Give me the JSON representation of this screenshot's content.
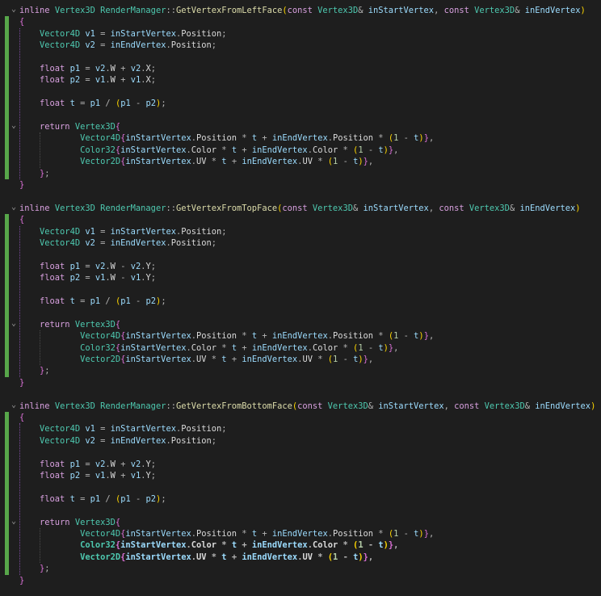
{
  "editor": {
    "functions": [
      {
        "signature": {
          "inline": "inline",
          "ret": "Vertex3D",
          "cls": "RenderManager",
          "sep": "::",
          "name": "GetVertexFromLeftFace",
          "open": "(",
          "c1": "const",
          "t1": "Vertex3D",
          "amp1": "&",
          "p1": "inStartVertex",
          "comma": ",",
          "c2": "const",
          "t2": "Vertex3D",
          "amp2": "&",
          "p2": "inEndVertex",
          "close": ")"
        },
        "body": [
          "{",
          "    Vector4D v1 = inStartVertex.Position;",
          "    Vector4D v2 = inEndVertex.Position;",
          "",
          "    float p1 = v2.W + v2.X;",
          "    float p2 = v1.W + v1.X;",
          "",
          "    float t = p1 / (p1 - p2);",
          "",
          "    return Vertex3D{",
          "            Vector4D{inStartVertex.Position * t + inEndVertex.Position * (1 - t)},",
          "            Color32{inStartVertex.Color * t + inEndVertex.Color * (1 - t)},",
          "            Vector2D{inStartVertex.UV * t + inEndVertex.UV * (1 - t)},",
          "    };",
          "}"
        ]
      },
      {
        "signature": {
          "inline": "inline",
          "ret": "Vertex3D",
          "cls": "RenderManager",
          "sep": "::",
          "name": "GetVertexFromTopFace",
          "open": "(",
          "c1": "const",
          "t1": "Vertex3D",
          "amp1": "&",
          "p1": "inStartVertex",
          "comma": ",",
          "c2": "const",
          "t2": "Vertex3D",
          "amp2": "&",
          "p2": "inEndVertex",
          "close": ")"
        },
        "body": [
          "{",
          "    Vector4D v1 = inStartVertex.Position;",
          "    Vector4D v2 = inEndVertex.Position;",
          "",
          "    float p1 = v2.W - v2.Y;",
          "    float p2 = v1.W - v1.Y;",
          "",
          "    float t = p1 / (p1 - p2);",
          "",
          "    return Vertex3D{",
          "            Vector4D{inStartVertex.Position * t + inEndVertex.Position * (1 - t)},",
          "            Color32{inStartVertex.Color * t + inEndVertex.Color * (1 - t)},",
          "            Vector2D{inStartVertex.UV * t + inEndVertex.UV * (1 - t)},",
          "    };",
          "}"
        ]
      },
      {
        "signature": {
          "inline": "inline",
          "ret": "Vertex3D",
          "cls": "RenderManager",
          "sep": "::",
          "name": "GetVertexFromBottomFace",
          "open": "(",
          "c1": "const",
          "t1": "Vertex3D",
          "amp1": "&",
          "p1": "inStartVertex",
          "comma": ",",
          "c2": "const",
          "t2": "Vertex3D",
          "amp2": "&",
          "p2": "inEndVertex",
          "close": ")"
        },
        "body": [
          "{",
          "    Vector4D v1 = inStartVertex.Position;",
          "    Vector4D v2 = inEndVertex.Position;",
          "",
          "    float p1 = v2.W + v2.Y;",
          "    float p2 = v1.W + v1.Y;",
          "",
          "    float t = p1 / (p1 - p2);",
          "",
          "    return Vertex3D{",
          "            Vector4D{inStartVertex.Position * t + inEndVertex.Position * (1 - t)},",
          "            Color32{inStartVertex.Color * t + inEndVertex.Color * (1 - t)},",
          "            Vector2D{inStartVertex.UV * t + inEndVertex.UV * (1 - t)},",
          "    };",
          "}"
        ]
      }
    ],
    "fold_icon": "chevron-down-icon",
    "colors": {
      "background": "#1e1e1e",
      "change_bar": "#57a64a",
      "keyword": "#d8a0df",
      "type": "#4ec9b0",
      "function": "#dcdcaa",
      "parameter": "#9cdcfe",
      "number": "#b5cea8"
    }
  }
}
